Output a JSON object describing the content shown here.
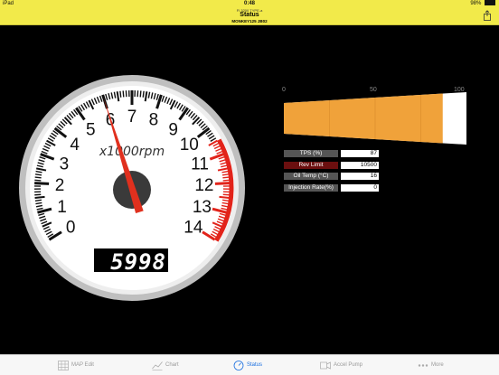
{
  "status_bar": {
    "carrier": "iPad",
    "time": "0:48",
    "battery": "98%"
  },
  "nav": {
    "subtitle": "FI 3200 TYPE-a",
    "title": "Status",
    "device": "MONKEY125 JB02"
  },
  "tachometer": {
    "unit_label": "x1000rpm",
    "scale_labels": [
      "0",
      "1",
      "2",
      "3",
      "4",
      "5",
      "6",
      "7",
      "8",
      "9",
      "10",
      "11",
      "12",
      "13",
      "14"
    ],
    "rpm_display": "5998",
    "rpm_value": 5998,
    "redline_start": 10500,
    "max_rpm": 14000
  },
  "bar": {
    "ticks": [
      "0",
      "50",
      "100"
    ],
    "value_fraction": 0.87
  },
  "readouts": [
    {
      "label": "TPS (%)",
      "value": "87",
      "label_bg": "#555555"
    },
    {
      "label": "Rev Limit",
      "value": "10500",
      "label_bg": "#6b0f0f"
    },
    {
      "label": "Oil Temp (°C)",
      "value": "16",
      "label_bg": "#555555"
    },
    {
      "label": "Injection Rate(%)",
      "value": "0",
      "label_bg": "#555555"
    }
  ],
  "tabs": [
    {
      "label": "MAP Edit",
      "icon": "grid-icon"
    },
    {
      "label": "Chart",
      "icon": "chart-icon"
    },
    {
      "label": "Status",
      "icon": "gauge-icon",
      "active": true
    },
    {
      "label": "Accel Pump",
      "icon": "pump-icon"
    },
    {
      "label": "More",
      "icon": "more-icon"
    }
  ],
  "colors": {
    "accent_bar": "#f0a23a",
    "needle": "#e0301e",
    "nav_bg": "#f2ea4a",
    "tab_active": "#1a6fe0"
  }
}
